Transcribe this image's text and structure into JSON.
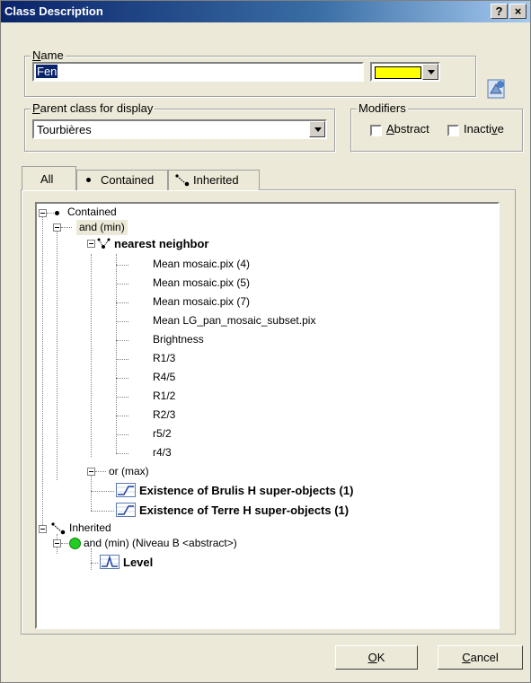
{
  "window": {
    "title": "Class Description",
    "help_label": "?",
    "close_label": "×"
  },
  "name_group": {
    "label": "Name",
    "value": "Fen",
    "color": "#ffff00"
  },
  "parent_group": {
    "label": "Parent class for display",
    "value": "Tourbières"
  },
  "modifiers": {
    "label": "Modifiers",
    "abstract_label": "Abstract",
    "inactive_label": "Inactive"
  },
  "tabs": [
    {
      "label": "All"
    },
    {
      "label": "Contained"
    },
    {
      "label": "Inherited"
    }
  ],
  "tree": {
    "contained": "Contained",
    "and_min": "and (min)",
    "nearest_neighbor": "nearest neighbor",
    "features": [
      "Mean mosaic.pix (4)",
      "Mean mosaic.pix (5)",
      "Mean mosaic.pix (7)",
      "Mean LG_pan_mosaic_subset.pix",
      "Brightness",
      "R1/3",
      "R4/5",
      "R1/2",
      "R2/3",
      "r5/2",
      "r4/3"
    ],
    "or_max": "or (max)",
    "existence_brulis": "Existence of Brulis H super-objects  (1)",
    "existence_terre": "Existence of Terre H super-objects  (1)",
    "inherited": "Inherited",
    "and_min_niveau": "and (min) (Niveau B <abstract>)",
    "level": "Level"
  },
  "buttons": {
    "ok": "OK",
    "cancel": "Cancel"
  }
}
